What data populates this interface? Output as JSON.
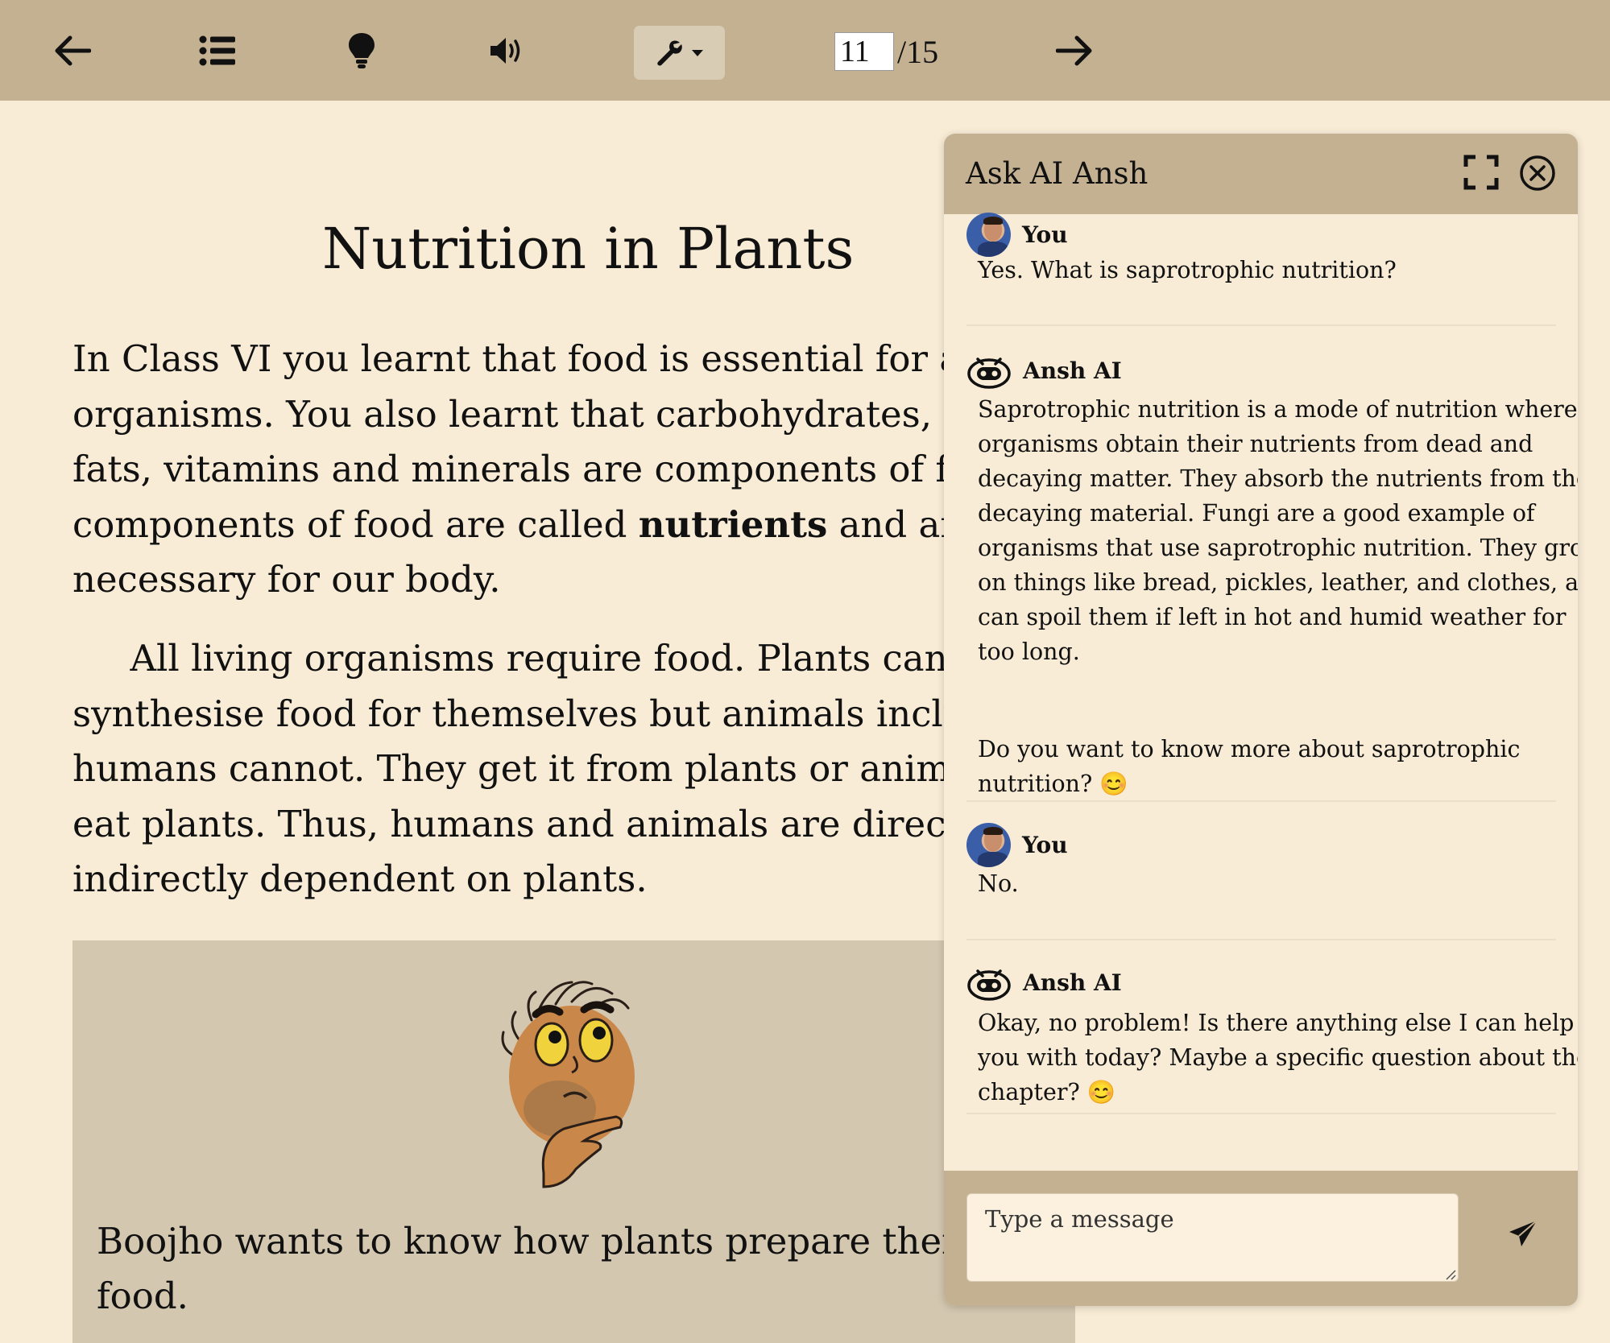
{
  "toolbar": {
    "back_icon": "arrow-left-icon",
    "toc_icon": "list-icon",
    "hint_icon": "lightbulb-icon",
    "audio_icon": "volume-icon",
    "tools_icon": "wrench-icon",
    "next_icon": "arrow-right-icon",
    "page_current": "11",
    "page_total": "/15"
  },
  "content": {
    "title": "Nutrition in Plants",
    "para1_line1": "In Class VI you learnt that food is essential for all liv",
    "para1_line2": "organisms. You also learnt that carbohydrates, prot",
    "para1_line3": "fats, vitamins and minerals are components of food",
    "para1_line4_start": "components of food are called ",
    "para1_line4_bold": "nutrients",
    "para1_line4_end": " and are",
    "para1_line5": "necessary for our body.",
    "para2_line1": "     All living organisms require food. Plants can",
    "para2_line2": "synthesise food for themselves but animals includir",
    "para2_line3": "humans cannot. They get it from plants or animals",
    "para2_line4": "eat plants. Thus, humans and animals are directly o",
    "para2_line5": "indirectly dependent on plants.",
    "callout_line1": "Boojho wants to know how plants prepare their ov",
    "callout_line2": "food."
  },
  "chat": {
    "title": "Ask AI Ansh",
    "messages": [
      {
        "sender": "You",
        "text": "Yes. What is saprotrophic nutrition?"
      },
      {
        "sender": "Ansh AI",
        "text": "Saprotrophic nutrition is a mode of nutrition where\norganisms obtain their nutrients from dead and\ndecaying matter. They absorb the nutrients from the\ndecaying material. Fungi are a good example of\norganisms that use saprotrophic nutrition. They grow\non things like bread, pickles, leather, and clothes, and\ncan spoil them if left in hot and humid weather for\ntoo long.",
        "text2": "Do you want to know more about saprotrophic\nnutrition? 😊"
      },
      {
        "sender": "You",
        "text": "No."
      },
      {
        "sender": "Ansh AI",
        "text": "Okay, no problem! Is there anything else I can help\nyou with today? Maybe a specific question about the\nchapter? 😊"
      }
    ],
    "input_placeholder": "Type a message"
  }
}
